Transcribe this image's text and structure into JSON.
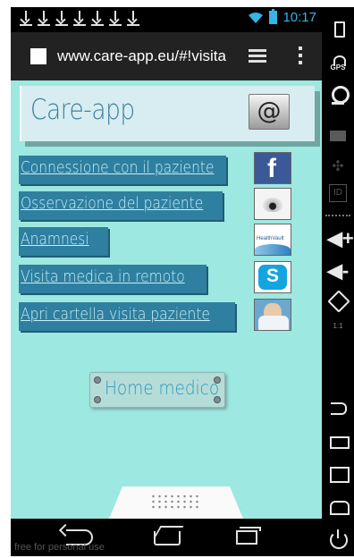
{
  "statusbar": {
    "notification_icons": [
      "download-icon",
      "download-icon",
      "download-icon",
      "download-icon",
      "download-icon",
      "download-icon",
      "download-icon"
    ],
    "time": "10:17",
    "accent_color": "#33b5e5"
  },
  "browser": {
    "url": "www.care-app.eu/#!visita",
    "tabs_icon": "tabs-icon",
    "menu_icon": "overflow-menu-icon"
  },
  "app": {
    "title": "Care-app",
    "at_button_icon": "at-sign-icon",
    "at_symbol": "@",
    "background_color": "#9de8e0",
    "menu": [
      {
        "label": "Connessione con il paziente",
        "icon": "facebook-icon",
        "glyph": "f"
      },
      {
        "label": "Osservazione del paziente",
        "icon": "security-camera-icon"
      },
      {
        "label": "Anamnesi",
        "icon": "healthvault-icon",
        "glyph": "HealthVault"
      },
      {
        "label": "Visita medica in remoto",
        "icon": "skype-icon",
        "glyph": "S"
      },
      {
        "label": "Apri cartella visita paziente",
        "icon": "doctor-icon"
      }
    ],
    "home_button": "Home medico"
  },
  "navbar": {
    "watermark": "free for personal use"
  },
  "emulator_toolbar": {
    "gps_label": "GPS",
    "scale_label": "1:1"
  }
}
